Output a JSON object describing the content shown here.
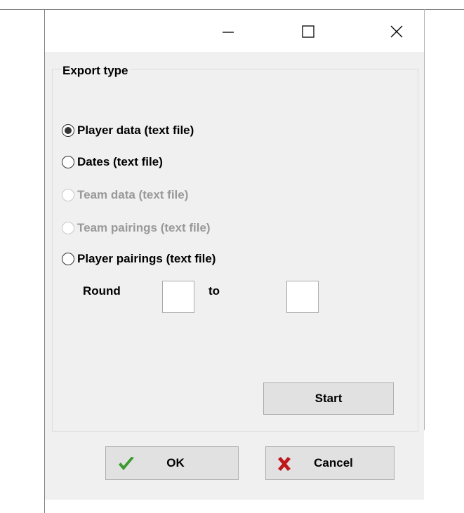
{
  "window": {
    "controls": {
      "minimize_icon": "minimize-icon",
      "maximize_icon": "maximize-icon",
      "close_icon": "close-icon"
    }
  },
  "export_group": {
    "title": "Export type",
    "options": [
      {
        "label": "Player data (text file)",
        "checked": true,
        "enabled": true
      },
      {
        "label": "Dates (text file)",
        "checked": false,
        "enabled": true
      },
      {
        "label": "Team data (text file)",
        "checked": false,
        "enabled": false
      },
      {
        "label": "Team pairings (text file)",
        "checked": false,
        "enabled": false
      },
      {
        "label": "Player pairings (text file)",
        "checked": false,
        "enabled": true
      }
    ],
    "round": {
      "label": "Round",
      "to_label": "to",
      "from_value": "",
      "to_value": ""
    },
    "start_label": "Start"
  },
  "footer": {
    "ok_label": "OK",
    "cancel_label": "Cancel",
    "colors": {
      "ok_check": "#3a9a2b",
      "cancel_x": "#c0171c"
    }
  }
}
